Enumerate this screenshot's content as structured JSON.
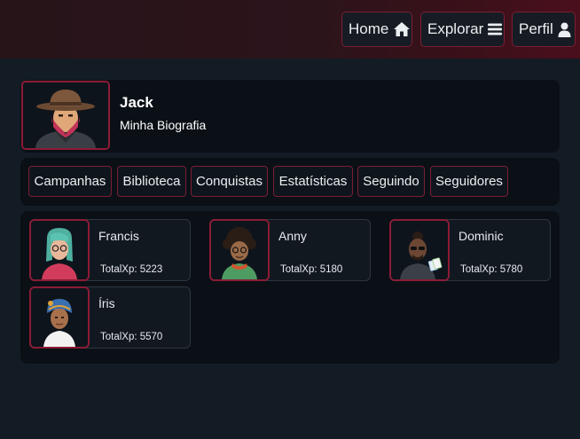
{
  "nav": {
    "items": [
      {
        "label": "Home",
        "icon": "home-icon"
      },
      {
        "label": "Explorar",
        "icon": "menu-icon"
      },
      {
        "label": "Perfil",
        "icon": "user-icon"
      }
    ]
  },
  "profile": {
    "name": "Jack",
    "bio": "Minha Biografia",
    "avatar": "cowboy-avatar"
  },
  "tabs": [
    "Campanhas",
    "Biblioteca",
    "Conquistas",
    "Estatísticas",
    "Seguindo",
    "Seguidores"
  ],
  "friends": [
    {
      "name": "Francis",
      "xp": "TotalXp: 5223",
      "avatar": "teal-hair-glasses-avatar"
    },
    {
      "name": "Anny",
      "xp": "TotalXp: 5180",
      "avatar": "curly-hair-avatar"
    },
    {
      "name": "Dominic",
      "xp": "TotalXp: 5780",
      "avatar": "sunglasses-cards-avatar"
    },
    {
      "name": "Íris",
      "xp": "TotalXp: 5570",
      "avatar": "headscarf-avatar"
    }
  ],
  "colors": {
    "accent_border": "#7a1e33",
    "background": "#131c24",
    "panel": "#0b1016",
    "topbar_end": "#4a0f1c"
  }
}
